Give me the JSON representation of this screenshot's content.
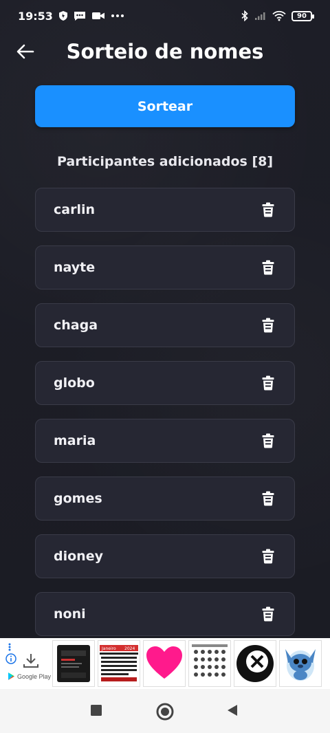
{
  "status_bar": {
    "time": "19:53",
    "battery": "90",
    "icons_left": [
      "shield-icon",
      "message-icon",
      "video-icon",
      "more-icon"
    ],
    "icons_right": [
      "bluetooth-icon",
      "signal-icon",
      "wifi-icon",
      "battery-icon"
    ]
  },
  "header": {
    "title": "Sorteio de nomes",
    "back_icon": "arrow-left-icon"
  },
  "draw_button": {
    "label": "Sortear",
    "color": "#1a90ff"
  },
  "participants": {
    "heading": "Participantes adicionados [8]",
    "items": [
      {
        "name": "carlin"
      },
      {
        "name": "nayte"
      },
      {
        "name": "chaga"
      },
      {
        "name": "globo"
      },
      {
        "name": "maria"
      },
      {
        "name": "gomes"
      },
      {
        "name": "dioney"
      },
      {
        "name": "noni"
      }
    ],
    "delete_icon": "trash-icon"
  },
  "ad": {
    "store_label": "Google Play",
    "thumbs": [
      "ad-thumb-dark-product",
      "ad-thumb-calendar",
      "ad-thumb-pink-heart",
      "ad-thumb-sheet",
      "ad-thumb-black-disc",
      "ad-thumb-stitch-sticker"
    ],
    "calendar_month": "Janeiro",
    "calendar_year": "2024"
  },
  "nav_bar": {
    "buttons": [
      "recents-square-icon",
      "home-circle-icon",
      "back-triangle-icon"
    ]
  },
  "colors": {
    "background": "#1c1d26",
    "card": "#262733",
    "card_border": "#3a3b48",
    "accent": "#1a90ff"
  }
}
